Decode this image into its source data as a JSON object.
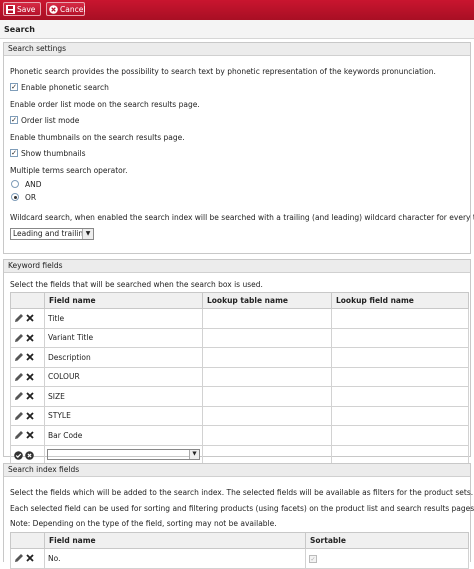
{
  "toolbar": {
    "save_label": "Save",
    "cancel_label": "Cancel"
  },
  "page": {
    "title": "Search"
  },
  "search_settings": {
    "header": "Search settings",
    "phonetic_desc": "Phonetic search provides the possibility to search text by phonetic representation of the keywords pronunciation.",
    "phonetic_label": "Enable phonetic search",
    "order_desc": "Enable order list mode on the search results page.",
    "order_label": "Order list mode",
    "thumbs_desc": "Enable thumbnails on the search results page.",
    "thumbs_label": "Show thumbnails",
    "operator_desc": "Multiple terms search operator.",
    "operator_and": "AND",
    "operator_or": "OR",
    "wildcard_desc": "Wildcard search, when enabled the search index will be searched with a trailing (and leading) wildcard character for every term.",
    "wildcard_value": "Leading and trailing"
  },
  "keyword_fields": {
    "header": "Keyword fields",
    "desc": "Select the fields that will be searched when the search box is used.",
    "columns": [
      "Field name",
      "Lookup table name",
      "Lookup field name"
    ],
    "rows": [
      "Title",
      "Variant Title",
      "Description",
      "COLOUR",
      "SIZE",
      "STYLE",
      "Bar Code"
    ]
  },
  "index_fields": {
    "header": "Search index fields",
    "desc1": "Select the fields which will be added to the search index. The selected fields will be available as filters for the product sets.",
    "desc2": "Each selected field can be used for sorting and filtering products (using facets) on the product list and search results pages.",
    "note": "Note: Depending on the type of the field, sorting may not be available.",
    "columns": [
      "Field name",
      "Sortable"
    ],
    "rows": [
      "No."
    ]
  },
  "icons": {
    "save": "save-icon",
    "cancel": "cancel-icon",
    "edit": "pencil-icon",
    "delete": "delete-icon",
    "confirm": "check-circle-icon",
    "discard": "x-circle-icon"
  }
}
